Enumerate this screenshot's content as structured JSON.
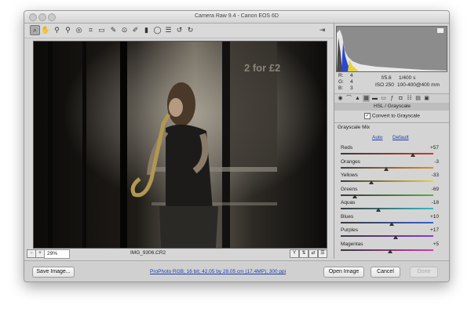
{
  "window": {
    "title": "Camera Raw 9.4  -  Canon EOS 6D"
  },
  "toolbar": {
    "tools": [
      "zoom-icon",
      "hand-icon",
      "white-balance-icon",
      "color-sampler-icon",
      "target-adjust-icon",
      "crop-icon",
      "straighten-icon",
      "spot-removal-icon",
      "red-eye-icon",
      "adjustment-brush-icon",
      "graduated-filter-icon",
      "radial-filter-icon",
      "preferences-icon",
      "rotate-ccw-icon",
      "rotate-cw-icon"
    ],
    "fullscreen": "fullscreen-icon"
  },
  "preview": {
    "sign_text": "2 for £2"
  },
  "status": {
    "zoom": "29%",
    "filename": "IMG_9306.CR2"
  },
  "readout": {
    "r_label": "R:",
    "r_value": "4",
    "g_label": "G:",
    "g_value": "4",
    "b_label": "B:",
    "b_value": "3",
    "aperture": "f/5.6",
    "shutter": "1/400 s",
    "iso": "ISO 250",
    "lens": "100-400@400 mm"
  },
  "panel": {
    "title": "HSL / Grayscale",
    "convert_label": "Convert to Grayscale",
    "convert_checked": "✓",
    "mix_label": "Grayscale Mix",
    "auto_label": "Auto",
    "default_label": "Default",
    "sliders": [
      {
        "label": "Reds",
        "value": "+57",
        "fraction": 0.78
      },
      {
        "label": "Oranges",
        "value": "-3",
        "fraction": 0.49
      },
      {
        "label": "Yellows",
        "value": "-33",
        "fraction": 0.33
      },
      {
        "label": "Greens",
        "value": "-69",
        "fraction": 0.15
      },
      {
        "label": "Aquas",
        "value": "-18",
        "fraction": 0.41
      },
      {
        "label": "Blues",
        "value": "+10",
        "fraction": 0.55
      },
      {
        "label": "Purples",
        "value": "+17",
        "fraction": 0.59
      },
      {
        "label": "Magentas",
        "value": "+5",
        "fraction": 0.53
      }
    ]
  },
  "bottom": {
    "save_label": "Save Image...",
    "workflow_link": "ProPhoto RGB; 16 bit; 42.05 by 28.05 cm (17.4MP); 300 ppi",
    "open_label": "Open Image",
    "cancel_label": "Cancel",
    "done_label": "Done"
  },
  "colors": {
    "reds": "#d23a2a",
    "oranges": "#e48a2a",
    "yellows": "#e6d23a",
    "greens": "#4fb04a",
    "aquas": "#3ab8c0",
    "blues": "#3a5fd0",
    "purples": "#8a3ad0",
    "magentas": "#d03ab0"
  }
}
